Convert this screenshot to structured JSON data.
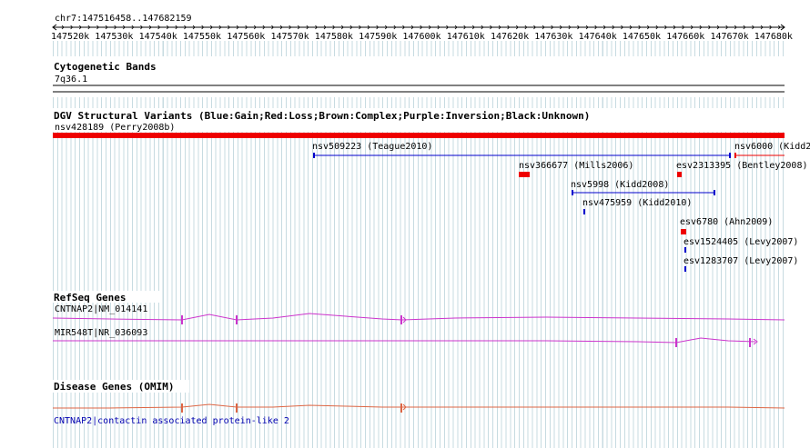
{
  "ruler": {
    "locus": "chr7:147516458..147682159",
    "ticks": [
      "147520k",
      "147530k",
      "147540k",
      "147550k",
      "147560k",
      "147570k",
      "147580k",
      "147590k",
      "147600k",
      "147610k",
      "147620k",
      "147630k",
      "147640k",
      "147650k",
      "147660k",
      "147670k",
      "147680k"
    ]
  },
  "cytobands": {
    "title": "Cytogenetic Bands",
    "band": "7q36.1"
  },
  "dgv": {
    "title": "DGV Structural Variants (Blue:Gain;Red:Loss;Brown:Complex;Purple:Inversion;Black:Unknown)",
    "features": [
      {
        "label": "nsv428189 (Perry2008b)",
        "type": "loss"
      },
      {
        "label": "nsv509223 (Teague2010)",
        "type": "gain"
      },
      {
        "label": "nsv6000 (Kidd2",
        "type": "loss"
      },
      {
        "label": "nsv366677 (Mills2006)",
        "type": "loss"
      },
      {
        "label": "esv2313395 (Bentley2008)",
        "type": "loss"
      },
      {
        "label": "nsv5998 (Kidd2008)",
        "type": "gain"
      },
      {
        "label": "nsv475959 (Kidd2010)",
        "type": "gain"
      },
      {
        "label": "esv6780 (Ahn2009)",
        "type": "loss"
      },
      {
        "label": "esv1524405 (Levy2007)",
        "type": "gain"
      },
      {
        "label": "esv1283707 (Levy2007)",
        "type": "gain"
      }
    ]
  },
  "refseq": {
    "title": "RefSeq Genes",
    "genes": [
      {
        "label": "CNTNAP2|NM_014141"
      },
      {
        "label": "MIR548T|NR_036093"
      }
    ]
  },
  "disease": {
    "title": "Disease Genes (OMIM)",
    "genes": [
      {
        "label": "CNTNAP2|contactin associated protein-like 2"
      }
    ]
  },
  "colors": {
    "gain": "#0000cc",
    "loss": "#ee0000",
    "refseq": "#cc33cc",
    "omim": "#dd6644",
    "grid": "#aac8d2"
  }
}
